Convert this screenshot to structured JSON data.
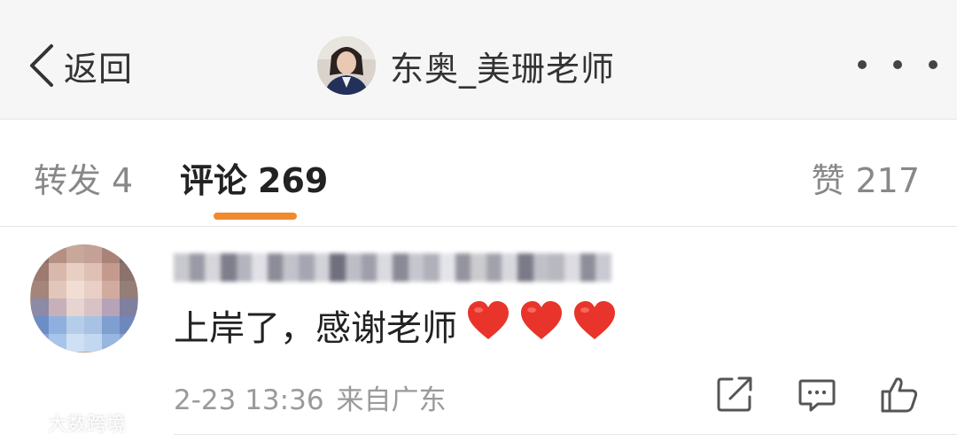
{
  "navbar": {
    "back_label": "返回",
    "title": "东奥_美珊老师",
    "more_icon": "more-dots-icon"
  },
  "tabs": [
    {
      "label": "转发",
      "count": "4"
    },
    {
      "label": "评论",
      "count": "269"
    },
    {
      "label": "赞",
      "count": "217"
    }
  ],
  "active_tab": "评论",
  "comment": {
    "text": "上岸了，感谢老师",
    "heart_count": 3,
    "timestamp": "2-23 13:36",
    "source": "来自广东",
    "actions": [
      "share-icon",
      "reply-icon",
      "like-icon"
    ]
  },
  "watermark": {
    "text": "大数跨境"
  },
  "colors": {
    "accent": "#f08a2e",
    "heart": "#e8342a",
    "nav_background": "#f6f6f6",
    "text_primary": "#222222",
    "text_secondary": "#888888",
    "meta": "#9a9a9a"
  }
}
